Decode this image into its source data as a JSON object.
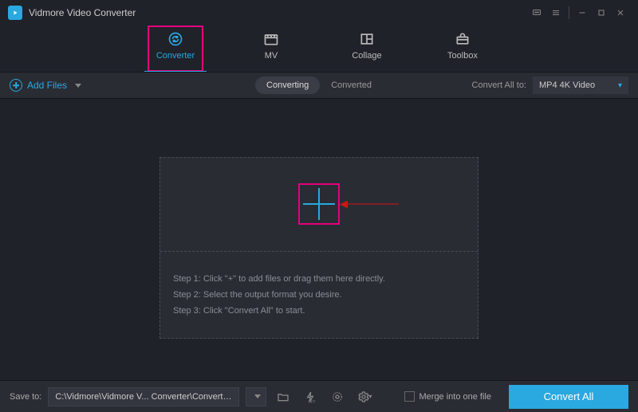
{
  "app": {
    "title": "Vidmore Video Converter"
  },
  "nav": {
    "items": [
      {
        "label": "Converter",
        "active": true
      },
      {
        "label": "MV"
      },
      {
        "label": "Collage"
      },
      {
        "label": "Toolbox"
      }
    ]
  },
  "subbar": {
    "add_files_label": "Add Files",
    "tabs": {
      "converting": "Converting",
      "converted": "Converted"
    },
    "convert_all_to_label": "Convert All to:",
    "format": "MP4 4K Video"
  },
  "dropzone": {
    "step1": "Step 1: Click \"+\" to add files or drag them here directly.",
    "step2": "Step 2: Select the output format you desire.",
    "step3": "Step 3: Click \"Convert All\" to start."
  },
  "bottom": {
    "save_to_label": "Save to:",
    "path": "C:\\Vidmore\\Vidmore V... Converter\\Converted",
    "merge_label": "Merge into one file",
    "convert_all_btn": "Convert All"
  }
}
